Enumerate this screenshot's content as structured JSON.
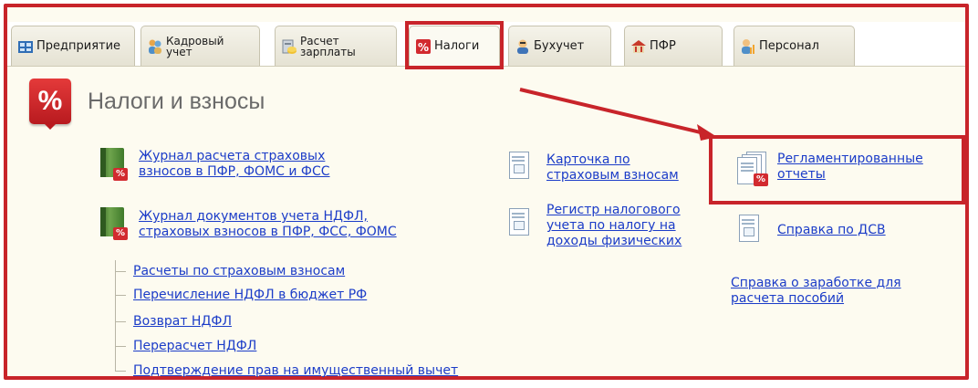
{
  "tabs": [
    {
      "label": "Предприятие",
      "icon": "enterprise-icon"
    },
    {
      "label": "Кадровый\nучет",
      "icon": "people-icon"
    },
    {
      "label": "Расчет\nзарплаты",
      "icon": "salary-icon"
    },
    {
      "label": "Налоги",
      "icon": "percent-icon",
      "active": true
    },
    {
      "label": "Бухучет",
      "icon": "accountant-icon"
    },
    {
      "label": "ПФР",
      "icon": "pfr-icon"
    },
    {
      "label": "Персонал",
      "icon": "personnel-icon"
    }
  ],
  "page": {
    "title": "Налоги и взносы",
    "badge": "%"
  },
  "links": {
    "journal_insurance": "Журнал расчета страховых\nвзносов в ПФР, ФОМС и ФСС",
    "journal_ndfl": "Журнал документов учета НДФЛ,\nстраховых взносов в ПФР, ФСС, ФОМС",
    "tree": [
      "Расчеты по страховым взносам",
      "Перечисление НДФЛ в бюджет РФ",
      "Возврат НДФЛ",
      "Перерасчет НДФЛ",
      "Подтверждение прав на имущественный вычет"
    ],
    "card_insurance": "Карточка по\nстраховым взносам",
    "tax_register": "Регистр налогового\nучета по налогу на\nдоходы физических",
    "regulated_reports": "Регламентированные\nотчеты",
    "dsv_certificate": "Справка по ДСВ",
    "earnings_certificate": "Справка о заработке для\nрасчета пособий"
  },
  "colors": {
    "highlight": "#c8242a",
    "link": "#1b3cc8",
    "background": "#fdfbf0"
  }
}
